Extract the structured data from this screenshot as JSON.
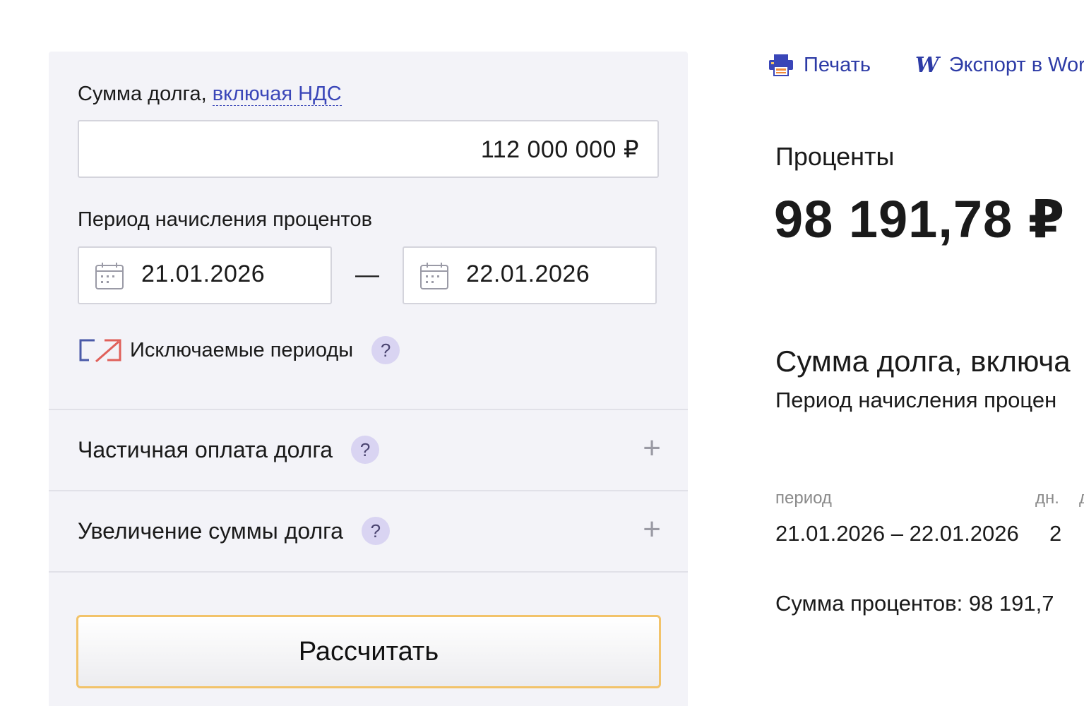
{
  "form": {
    "debt_label": "Сумма долга, ",
    "vat_link": "включая НДС",
    "debt_value": "112 000 000 ₽",
    "period_label": "Период начисления процентов",
    "date_from": "21.01.2026",
    "date_to": "22.01.2026",
    "date_separator": "—",
    "excluded_periods": "Исключаемые периоды",
    "help_mark": "?",
    "partial_payment": "Частичная оплата долга",
    "debt_increase": "Увеличение суммы долга",
    "expand_symbol": "+",
    "calculate_button": "Рассчитать"
  },
  "toolbar": {
    "print_label": "Печать",
    "word_icon_letter": "W",
    "export_label": "Экспорт в Wor"
  },
  "results": {
    "heading": "Проценты",
    "amount": "98 191,78 ₽",
    "debt_line": "Сумма долга, включа",
    "period_line": "Период начисления процен",
    "table": {
      "col_period": "период",
      "col_days": "дн.",
      "col_third": "д",
      "rows": [
        {
          "period": "21.01.2026 – 22.01.2026",
          "days": "2"
        }
      ]
    },
    "total_line": "Сумма процентов: 98 191,7"
  },
  "colors": {
    "panel_bg": "#f3f3f8",
    "link": "#2d3ba6",
    "button_border": "#f2c36a",
    "help_bg": "#d9d4f2",
    "exclude_icon_red": "#e0605a",
    "exclude_icon_blue": "#4a5aa8"
  },
  "icons": [
    "calendar-icon",
    "printer-icon",
    "word-icon",
    "exclude-periods-icon",
    "help-icon",
    "plus-icon"
  ]
}
